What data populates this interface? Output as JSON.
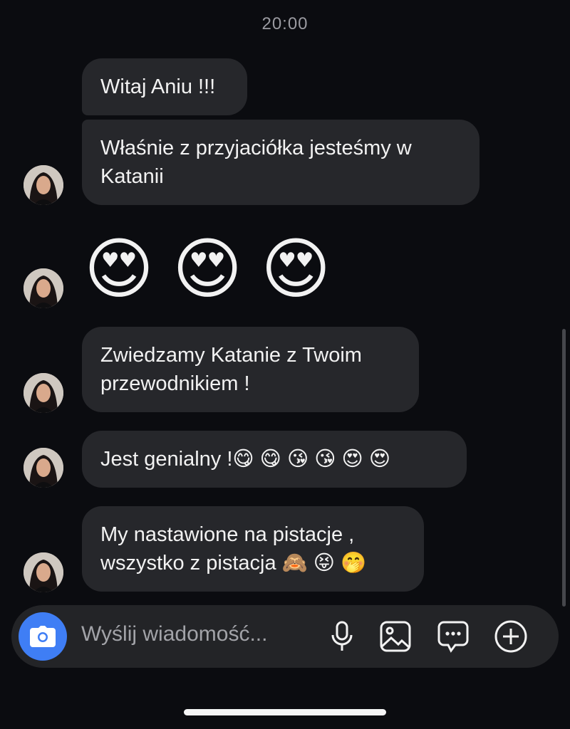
{
  "header": {
    "timestamp": "20:00"
  },
  "messages": [
    {
      "text": "Witaj Aniu !!!"
    },
    {
      "text_line1": "Właśnie z przyjaciółka jesteśmy w",
      "text_line2": "Katanii"
    },
    {
      "emoji": "😍 😍 😍"
    },
    {
      "text_line1": "Zwiedzamy Katanie z Twoim",
      "text_line2": "przewodnikiem !"
    },
    {
      "text": "Jest genialny !😋 😋 😘 😘 😍 😍"
    },
    {
      "text_line1": "My nastawione na pistacje ,",
      "text_line2": "wszystko z pistacja 🙈 😝 🤭"
    }
  ],
  "composer": {
    "placeholder": "Wyślij wiadomość...",
    "icons": [
      "camera-icon",
      "microphone-icon",
      "gallery-icon",
      "sticker-icon",
      "plus-icon"
    ],
    "camera_color": "#3f7ef5"
  },
  "colors": {
    "background": "#0b0c10",
    "bubble": "#26272b",
    "text": "#f2f2f2"
  }
}
